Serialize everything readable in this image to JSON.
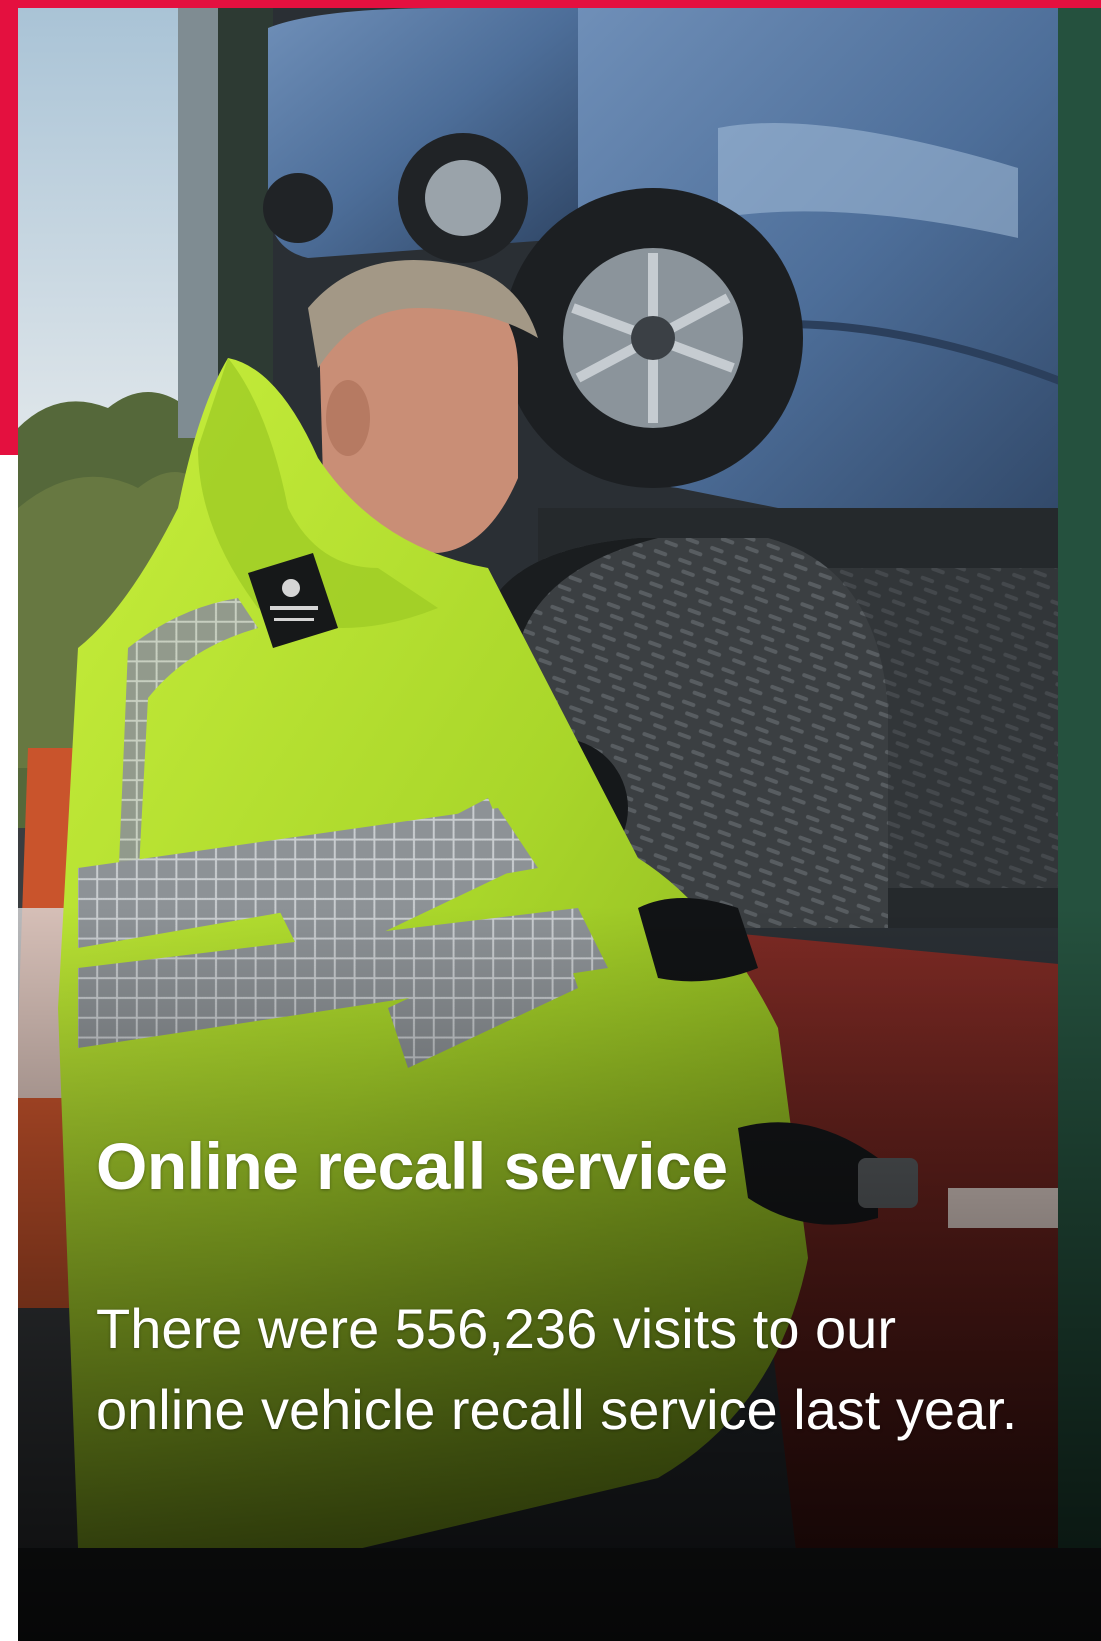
{
  "card": {
    "title": "Online recall service",
    "body": "There were 556,236 visits to our online vehicle recall service last year.",
    "image_alt": "Vehicle examiner in a high-visibility jacket inspecting a car transporter wheel"
  },
  "colors": {
    "accent": "#e4103f",
    "text": "#ffffff",
    "hi_vis": "#b5e02e"
  }
}
